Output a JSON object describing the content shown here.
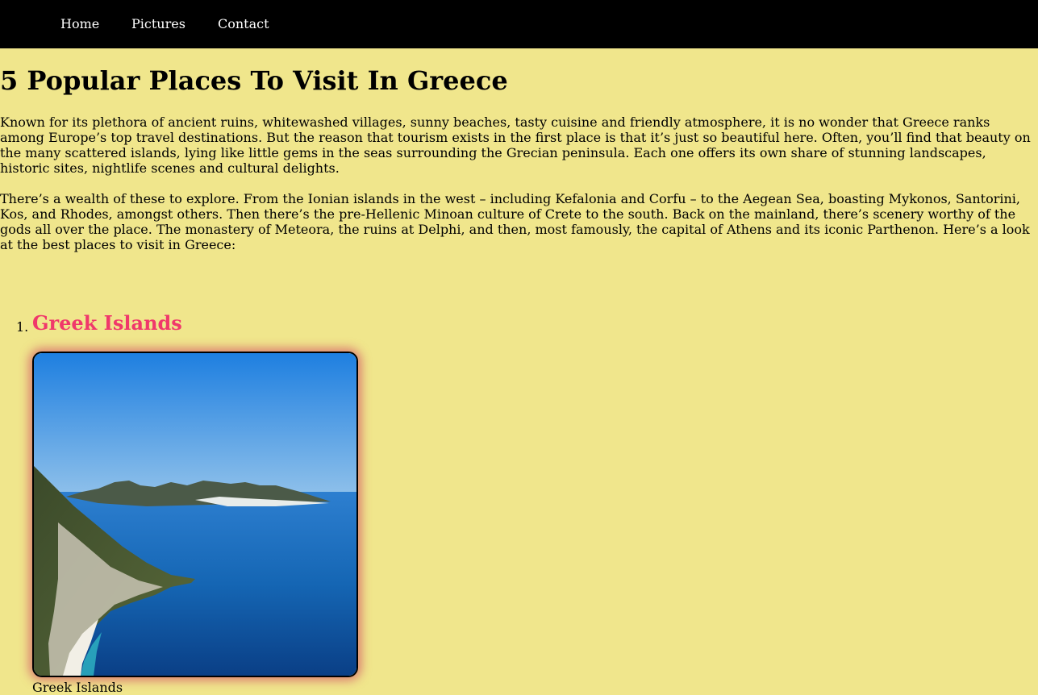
{
  "nav": {
    "items": [
      {
        "label": "Home"
      },
      {
        "label": "Pictures"
      },
      {
        "label": "Contact"
      }
    ]
  },
  "page": {
    "title": "5 Popular Places To Visit In Greece",
    "paragraphs": [
      "Known for its plethora of ancient ruins, whitewashed villages, sunny beaches, tasty cuisine and friendly atmosphere, it is no wonder that Greece ranks among Europe’s top travel destinations. But the reason that tourism exists in the first place is that it’s just so beautiful here. Often, you’ll find that beauty on the many scattered islands, lying like little gems in the seas surrounding the Grecian peninsula. Each one offers its own share of stunning landscapes, historic sites, nightlife scenes and cultural delights.",
      "There’s a wealth of these to explore. From the Ionian islands in the west – including Kefalonia and Corfu – to the Aegean Sea, boasting Mykonos, Santorini, Kos, and Rhodes, amongst others. Then there’s the pre-Hellenic Minoan culture of Crete to the south. Back on the mainland, there’s scenery worthy of the gods all over the place. The monastery of Meteora, the ruins at Delphi, and then, most famously, the capital of Athens and its iconic Parthenon. Here’s a look at the best places to visit in Greece:"
    ]
  },
  "places": [
    {
      "marker": "1.",
      "heading": "Greek Islands",
      "caption": "Greek Islands"
    }
  ],
  "colors": {
    "page_background": "#f0e68c",
    "navbar_background": "#000000",
    "heading_accent": "#f0386b"
  }
}
